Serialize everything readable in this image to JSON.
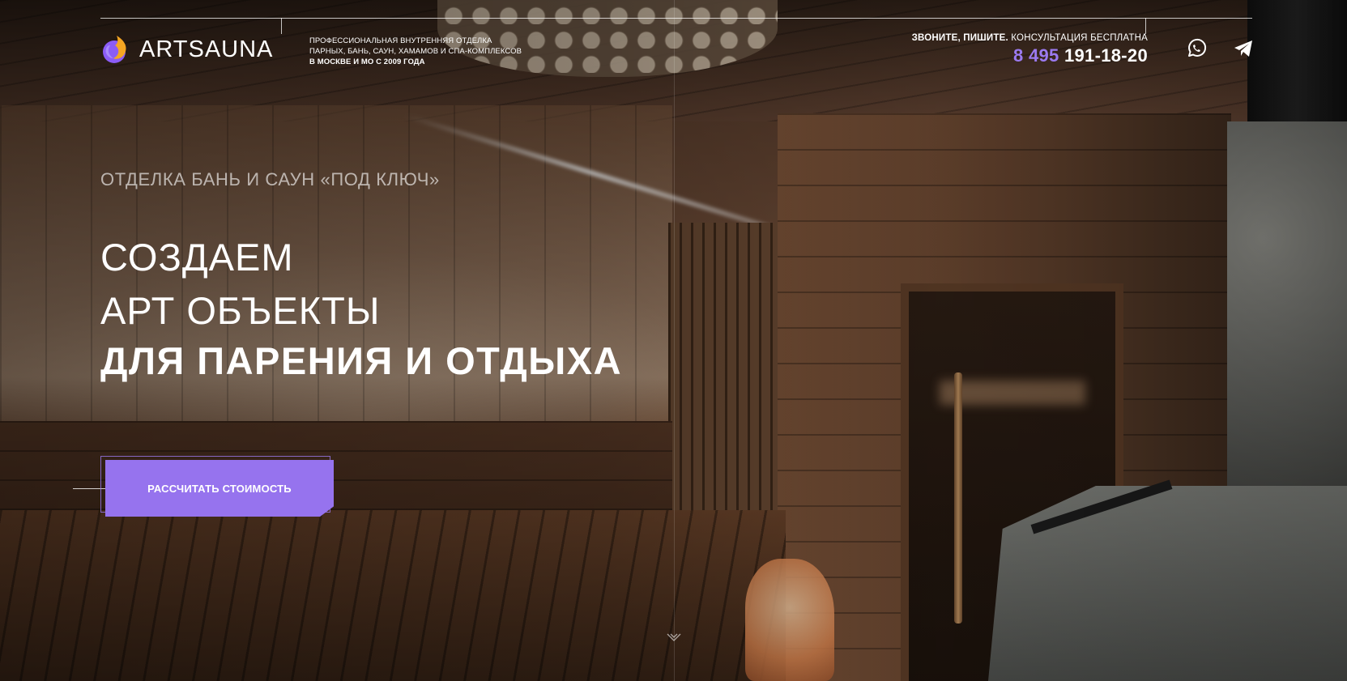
{
  "brand": {
    "name": "ARTSAUNA",
    "accent": "#9673ee",
    "logo_colors": [
      "#f5a623",
      "#8b5cf6"
    ]
  },
  "tagline": {
    "line1": "ПРОФЕССИОНАЛЬНАЯ ВНУТРЕННЯЯ ОТДЕЛКА",
    "line2": "ПАРНЫХ, БАНЬ, САУН, ХАМАМОВ И СПА-КОМПЛЕКСОВ",
    "line3": "В МОСКВЕ И МО С 2009 ГОДА"
  },
  "contact": {
    "label_bold": "ЗВОНИТЕ, ПИШИТЕ.",
    "label_rest": " КОНСУЛЬТАЦИЯ БЕСПЛАТНА",
    "phone_code": "8 495",
    "phone_number": " 191-18-20"
  },
  "social": [
    {
      "name": "whatsapp",
      "icon": "whatsapp-icon"
    },
    {
      "name": "telegram",
      "icon": "telegram-icon"
    }
  ],
  "hero": {
    "eyebrow": "ОТДЕЛКА БАНЬ И САУН «ПОД КЛЮЧ»",
    "line1": "СОЗДАЕМ",
    "line2": "АРТ ОБЪЕКТЫ",
    "line3": "ДЛЯ ПАРЕНИЯ И ОТДЫХА",
    "cta_label": "РАССЧИТАТЬ СТОИМОСТЬ"
  }
}
